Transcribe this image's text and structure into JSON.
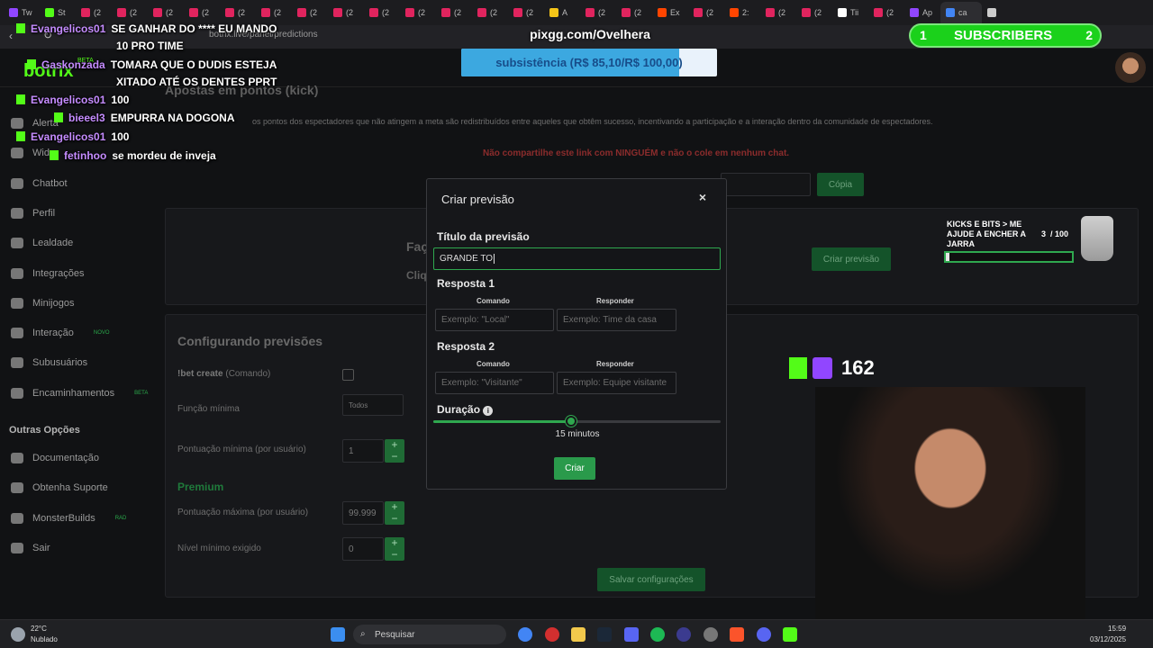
{
  "browser": {
    "tabs": [
      {
        "label": "Tw",
        "color": "#9146ff"
      },
      {
        "label": "St",
        "color": "#53fc18"
      },
      {
        "label": "(2",
        "color": "#e0245e"
      },
      {
        "label": "(2",
        "color": "#e0245e"
      },
      {
        "label": "(2",
        "color": "#e0245e"
      },
      {
        "label": "(2",
        "color": "#e0245e"
      },
      {
        "label": "(2",
        "color": "#e0245e"
      },
      {
        "label": "(2",
        "color": "#e0245e"
      },
      {
        "label": "(2",
        "color": "#e0245e"
      },
      {
        "label": "(2",
        "color": "#e0245e"
      },
      {
        "label": "(2",
        "color": "#e0245e"
      },
      {
        "label": "(2",
        "color": "#e0245e"
      },
      {
        "label": "(2",
        "color": "#e0245e"
      },
      {
        "label": "(2",
        "color": "#e0245e"
      },
      {
        "label": "(2",
        "color": "#e0245e"
      },
      {
        "label": "A",
        "color": "#f5c518"
      },
      {
        "label": "(2",
        "color": "#e0245e"
      },
      {
        "label": "(2",
        "color": "#e0245e"
      },
      {
        "label": "Ex",
        "color": "#ff4500"
      },
      {
        "label": "(2",
        "color": "#e0245e"
      },
      {
        "label": "2:",
        "color": "#ff4500"
      },
      {
        "label": "(2",
        "color": "#e0245e"
      },
      {
        "label": "(2",
        "color": "#e0245e"
      },
      {
        "label": "Tii",
        "color": "#ffffff"
      },
      {
        "label": "(2",
        "color": "#e0245e"
      },
      {
        "label": "Ap",
        "color": "#9146ff"
      },
      {
        "label": "ca",
        "color": "#4285f4"
      },
      {
        "label": "",
        "color": "#cccccc"
      }
    ],
    "url": "botrix.live/panel/predictions"
  },
  "app": {
    "logo": "botrix",
    "logo_badge": "BETA",
    "page_heading": "Apostas em pontos (kick)",
    "description": "os pontos dos espectadores que não atingem a meta são redistribuídos entre aqueles que obtêm sucesso, incentivando a participação e a interação dentro da comunidade de espectadores.",
    "warning": "Não compartilhe este link com NINGUÉM e não o cole em nenhum chat.",
    "link_value": "",
    "copy_label": "Cópia",
    "create_prediction_label": "Criar previsão",
    "faq_fragment": "Faç",
    "click_fragment": "Cliq",
    "sidebar": [
      {
        "label": "Alerta",
        "tag": ""
      },
      {
        "label": "Wid",
        "tag": ""
      },
      {
        "label": "Chatbot",
        "tag": ""
      },
      {
        "label": "Perfil",
        "tag": ""
      },
      {
        "label": "Lealdade",
        "tag": ""
      },
      {
        "label": "Integrações",
        "tag": ""
      },
      {
        "label": "Minijogos",
        "tag": ""
      },
      {
        "label": "Interação",
        "tag": "NOVO"
      },
      {
        "label": "Subusuários",
        "tag": ""
      },
      {
        "label": "Encaminhamentos",
        "tag": "BETA"
      }
    ],
    "other_options": "Outras Opções",
    "sidebar_other": [
      {
        "label": "Documentação",
        "tag": ""
      },
      {
        "label": "Obtenha Suporte",
        "tag": ""
      },
      {
        "label": "MonsterBuilds",
        "tag": "RAD"
      },
      {
        "label": "Sair",
        "tag": ""
      }
    ],
    "config": {
      "heading": "Configurando previsões",
      "bet_create": "!bet create",
      "bet_create_suffix": "(Comando)",
      "min_function": "Função mínima",
      "min_function_value": "Todos",
      "min_points": "Pontuação mínima (por usuário)",
      "min_points_value": "1",
      "premium": "Premium",
      "max_points": "Pontuação máxima (por usuário)",
      "max_points_value": "99.999",
      "min_level": "Nível mínimo exigido",
      "min_level_value": "0",
      "save": "Salvar configurações"
    }
  },
  "modal": {
    "title": "Criar previsão",
    "close": "×",
    "title_label": "Título da previsão",
    "title_value": "GRANDE TO",
    "answer1_label": "Resposta 1",
    "answer2_label": "Resposta 2",
    "command_label": "Comando",
    "reply_label": "Responder",
    "answer1_command_placeholder": "Exemplo: \"Local\"",
    "answer1_reply_placeholder": "Exemplo: Time da casa",
    "answer2_command_placeholder": "Exemplo: \"Visitante\"",
    "answer2_reply_placeholder": "Exemplo: Equipe visitante",
    "duration_label": "Duração",
    "duration_fraction": 0.48,
    "duration_value": "15 minutos",
    "create_button": "Criar"
  },
  "overlay": {
    "pix": "pixgg.com/Ovelhera",
    "goal_text": "subsistência (R$ 85,10/R$ 100,00)",
    "goal_fraction": 0.851,
    "subs_left": "1",
    "subs_label": "SUBSCRIBERS",
    "subs_right": "2",
    "jar_text": "KICKS E BITS > ME AJUDE A ENCHER A JARRA",
    "jar_count": "3",
    "jar_total": "/ 100",
    "jar_fraction": 0.03,
    "viewers": "162",
    "chat": [
      {
        "user": "Evangelicos01",
        "msg": "SE GANHAR DO **** EU MANDO"
      },
      {
        "user": "",
        "msg": "10 PRO TIME"
      },
      {
        "user": "Gaskonzada",
        "msg": "TOMARA QUE O DUDIS ESTEJA"
      },
      {
        "user": "",
        "msg": "XITADO ATÉ OS DENTES PPRT"
      },
      {
        "user": "Evangelicos01",
        "msg": "100"
      },
      {
        "user": "bieeel3",
        "msg": "EMPURRA NA DOGONA"
      },
      {
        "user": "Evangelicos01",
        "msg": "100"
      },
      {
        "user": "fetinhoo",
        "msg": "se mordeu de inveja"
      }
    ]
  },
  "taskbar": {
    "temp": "22°C",
    "weather": "Nublado",
    "search": "Pesquisar",
    "time": "15:59",
    "date": "03/12/2025"
  }
}
